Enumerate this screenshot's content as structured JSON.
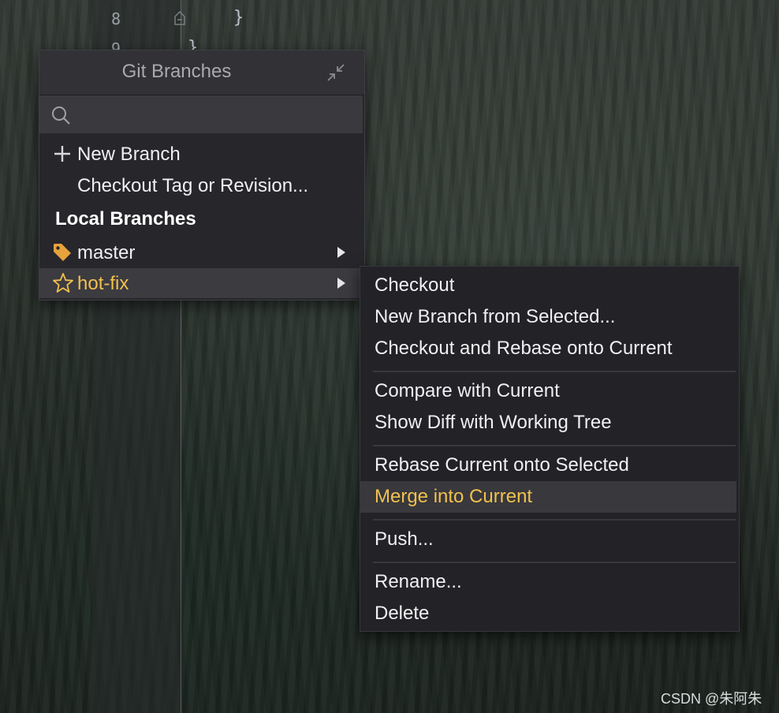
{
  "editor": {
    "line_number": "8",
    "line_number_partial": "9",
    "code_brace": "}",
    "code_brace_partial": "}"
  },
  "popup": {
    "title": "Git Branches",
    "search_placeholder": "",
    "actions": [
      {
        "label": "New Branch",
        "icon": "plus-icon"
      },
      {
        "label": "Checkout Tag or Revision..."
      }
    ],
    "local_branches_label": "Local Branches",
    "branches": [
      {
        "label": "master",
        "icon": "tag-icon",
        "icon_color": "#e6a23c"
      },
      {
        "label": "hot-fix",
        "icon": "star-icon",
        "icon_color": "#f2c14e",
        "selected": true
      }
    ]
  },
  "submenu": {
    "groups": [
      [
        "Checkout",
        "New Branch from Selected...",
        "Checkout and Rebase onto Current"
      ],
      [
        "Compare with Current",
        "Show Diff with Working Tree"
      ],
      [
        "Rebase Current onto Selected",
        "Merge into Current"
      ],
      [
        "Push..."
      ],
      [
        "Rename...",
        "Delete"
      ]
    ],
    "highlighted": "Merge into Current",
    "accent_color": "#f2c14e"
  },
  "watermark": "CSDN @朱阿朱"
}
